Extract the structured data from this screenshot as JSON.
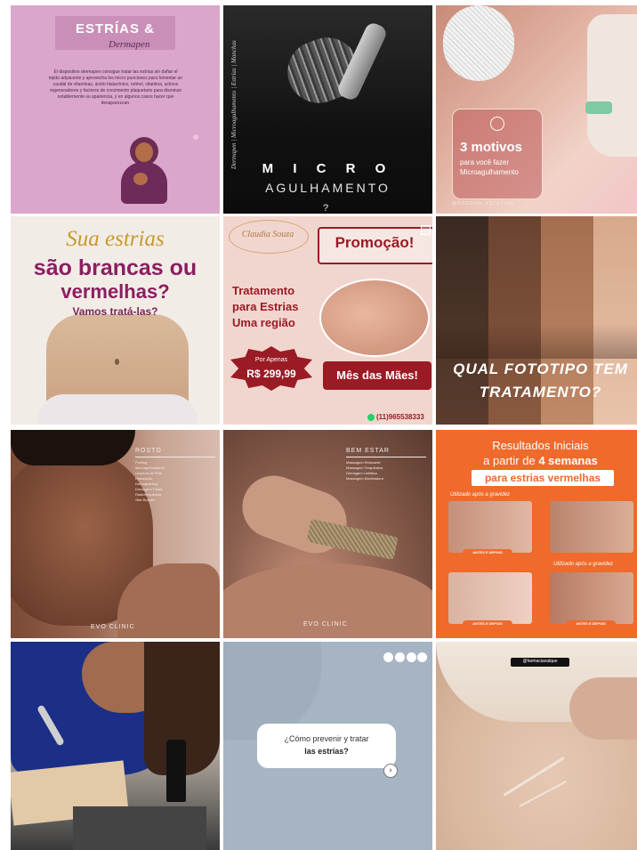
{
  "tiles": {
    "t1": {
      "title": "ESTRÍAS &",
      "script": "Dermapen",
      "body": "El dispositivo dermapen consigue tratar las estrías sin dañar el tejido adyacente y aprovecha los micro punciones para fomentar un caudal de vitaminas, ácido hialurónico, retinol, vitamina, activos regeneradores y factores de crecimiento plaquetario para disminuir notablemente su apariencia, y en algunos casos hacer que desaparezcan."
    },
    "t2": {
      "vertical": "Dermapen | Microagulhamento | Estrías | Manchas",
      "line1": "M I C R O",
      "line2": "AGULHAMENTO",
      "mark": "?"
    },
    "t3": {
      "big": "3 motivos",
      "small1": "para você fazer",
      "small2": "Microagulhamento",
      "footer": "@BOGDAN_ESTETICA"
    },
    "t4": {
      "script": "Sua estrias",
      "line1": "são brancas ou",
      "line2": "vermelhas?",
      "line3": "Vamos tratá-las?"
    },
    "t5": {
      "brand": "Claudia Souza",
      "promo": "Promoção!",
      "tr1": "Tratamento",
      "tr2": "para Estrias",
      "tr3": "Uma região",
      "por": "Por Apenas",
      "price": "R$ 299,99",
      "mes": "Mês das Mães!",
      "phone": "(11)965538333"
    },
    "t6": {
      "line1": "QUAL FOTOTIPO TEM",
      "line2": "TRATAMENTO?"
    },
    "t7": {
      "title": "ROSTO",
      "items": [
        "Peeling",
        "Microagulhamento",
        "Limpeza de Pele",
        "Hidratação",
        "Dermaplaning",
        "Drenagem Facial",
        "Radiofrequência",
        "Skin Booster"
      ],
      "brand": "EVO CLINIC"
    },
    "t8": {
      "title": "BEM ESTAR",
      "items": [
        "Massagem Relaxante",
        "Massagem Terapêutica",
        "Drenagem Linfática",
        "Massagem Modeladora"
      ],
      "brand": "EVO CLINIC"
    },
    "t9": {
      "h1": "Resultados Iniciais",
      "h2pre": "a partir de",
      "h2bold": "4 semanas",
      "band": "para estrias vermelhas",
      "cap1": "Utilizado após a gravidez",
      "cap2": "Utilizado após a gravidez",
      "badge": "ANTES E DEPOIS"
    },
    "t11": {
      "q1": "¿Cómo prevenir y tratar",
      "q2": "las estrías?"
    },
    "t12": {
      "tag": "@farmaciavalque"
    }
  },
  "colors": {
    "pink": "#d9a3c8",
    "promoRed": "#9a1b24",
    "orange": "#ef6a2b",
    "gray": "#a6b4c3"
  }
}
